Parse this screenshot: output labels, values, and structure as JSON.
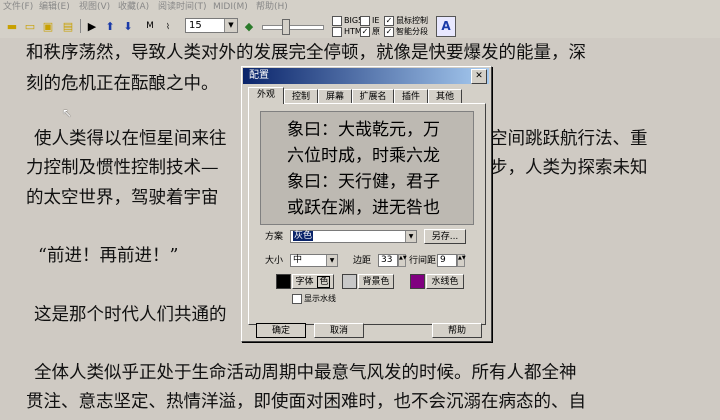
{
  "menu": [
    "文件(F)",
    "编辑(E)",
    "视图(V)",
    "收藏(A)",
    "阅读时间(T)",
    "MIDI(M)",
    "帮助(H)"
  ],
  "toolbar": {
    "font_size": "15",
    "checkboxes": [
      {
        "label": "BIG5",
        "checked": false
      },
      {
        "label": "IE",
        "checked": false
      },
      {
        "label": "鼠标控制",
        "checked": true
      },
      {
        "label": "HTML",
        "checked": false
      },
      {
        "label": "原",
        "checked": true
      },
      {
        "label": "智能分段",
        "checked": true
      }
    ]
  },
  "reader": {
    "lines": [
      "和秩序荡然，导致人类对外的发展完全停顿，就像是快要爆发的能量，深",
      "刻的危机正在酝酿之中。",
      "使人类得以在恒星间来往",
      "力控制及惯性控制技术—",
      "的太空世界，驾驶着宇宙",
      "“前进！再前进！”",
      "这是那个时代人们共通的",
      "全体人类似乎正处于生命活动周期中最意气风发的时候。所有人都全神",
      "贯注、意志坚定、热情洋溢，即使面对困难时，也不会沉溺在病态的、自"
    ],
    "line_right_fragments": [
      "空间跳跃航行法、重",
      "步，人类为探索未知"
    ]
  },
  "dialog": {
    "title": "配置",
    "tabs": [
      "外观",
      "控制",
      "屏幕",
      "扩展名",
      "插件",
      "其他"
    ],
    "preview_lines": [
      "象曰：大哉乾元，万",
      "六位时成，时乘六龙",
      "象曰：天行健，君子",
      "或跃在渊，进无咎也"
    ],
    "scheme_label": "方案",
    "scheme_value": "灰色",
    "save_as": "另存...",
    "size_label": "大小",
    "size_value": "中",
    "margin_label": "边距",
    "margin_value": "33",
    "line_spacing_label": "行间距",
    "line_spacing_value": "9",
    "font_color_btn": "字体",
    "font_color_extra": "色",
    "bg_color_btn": "背景色",
    "watermark_color_btn": "水线色",
    "show_watermark": "显示水线",
    "ok": "确定",
    "cancel": "取消",
    "help": "帮助",
    "colors": {
      "font": "#000000",
      "background": "#c8c8c8",
      "watermark": "#800080"
    }
  }
}
